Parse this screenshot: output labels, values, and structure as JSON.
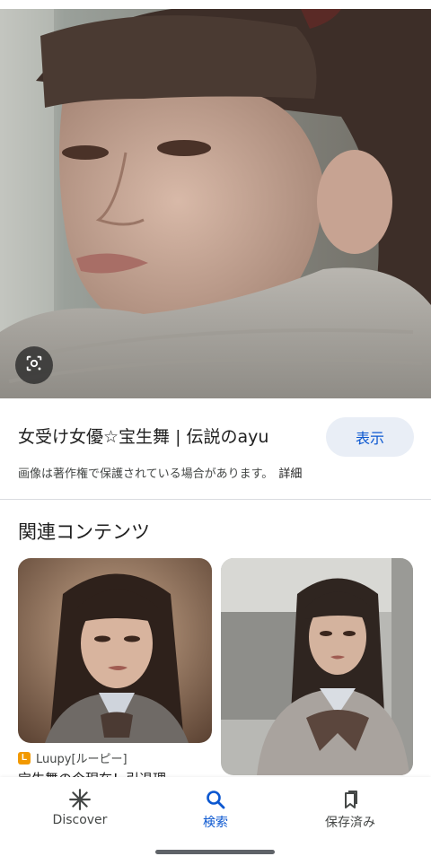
{
  "result": {
    "title": "女受け女優☆宝生舞 | 伝説のayu",
    "visit_label": "表示",
    "copyright_notice": "画像は著作権で保護されている場合があります。",
    "details_label": "詳細"
  },
  "related": {
    "heading": "関連コンテンツ",
    "cards": [
      {
        "source": "Luupy[ルーピー]",
        "title": "宝生舞の今現在！引退理"
      }
    ]
  },
  "nav": {
    "items": [
      {
        "label": "Discover",
        "icon": "asterisk-icon"
      },
      {
        "label": "検索",
        "icon": "search-icon"
      },
      {
        "label": "保存済み",
        "icon": "bookmarks-icon"
      }
    ],
    "active": "検索"
  },
  "colors": {
    "accent": "#0b57d0",
    "visit_bg": "#e9eef6",
    "divider": "#dadce0"
  }
}
